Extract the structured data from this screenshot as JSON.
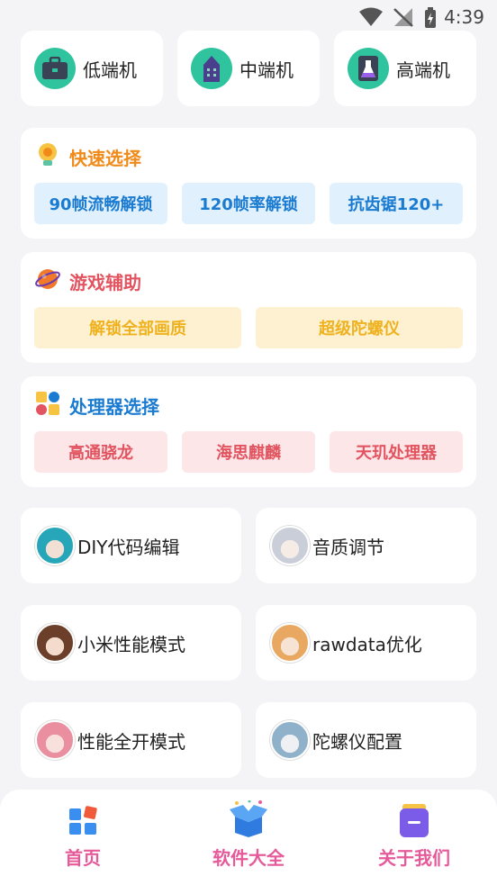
{
  "status_bar": {
    "time": "4:39"
  },
  "tiers": [
    {
      "label": "低端机"
    },
    {
      "label": "中端机"
    },
    {
      "label": "高端机"
    }
  ],
  "quick_select": {
    "title": "快速选择",
    "chips": [
      "90帧流畅解锁",
      "120帧率解锁",
      "抗齿锯120+"
    ]
  },
  "game_assist": {
    "title": "游戏辅助",
    "chips": [
      "解锁全部画质",
      "超级陀螺仪"
    ]
  },
  "processor_select": {
    "title": "处理器选择",
    "chips": [
      "高通骁龙",
      "海思麒麟",
      "天玑处理器"
    ]
  },
  "tiles": [
    {
      "label": "DIY代码编辑"
    },
    {
      "label": "音质调节"
    },
    {
      "label": "小米性能模式"
    },
    {
      "label": "rawdata优化"
    },
    {
      "label": "性能全开模式"
    },
    {
      "label": "陀螺仪配置"
    }
  ],
  "bottom_nav": [
    {
      "label": "首页"
    },
    {
      "label": "软件大全"
    },
    {
      "label": "关于我们"
    }
  ],
  "colors": {
    "quick_title": "#f08a19",
    "game_title": "#e2545f",
    "processor_title": "#1a7bd1",
    "nav_label": "#e75a9a"
  }
}
